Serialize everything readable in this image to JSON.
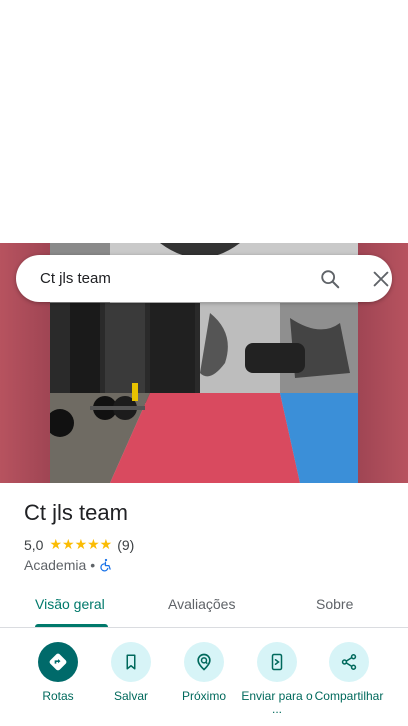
{
  "search": {
    "query": "Ct jls team"
  },
  "place": {
    "name": "Ct jls team",
    "rating": "5,0",
    "stars": "★★★★★",
    "review_count": "(9)",
    "category": "Academia",
    "separator": "•"
  },
  "tabs": [
    {
      "label": "Visão geral"
    },
    {
      "label": "Avaliações"
    },
    {
      "label": "Sobre"
    }
  ],
  "actions": [
    {
      "label": "Rotas",
      "icon": "directions-icon"
    },
    {
      "label": "Salvar",
      "icon": "bookmark-icon"
    },
    {
      "label": "Próximo",
      "icon": "nearby-icon"
    },
    {
      "label": "Enviar para o ...",
      "icon": "send-to-phone-icon"
    },
    {
      "label": "Compartilhar",
      "icon": "share-icon"
    }
  ],
  "colors": {
    "accent": "#00796b",
    "star": "#fbbc04",
    "action_bg": "#d7f4f7",
    "primary_action": "#006a6a"
  }
}
